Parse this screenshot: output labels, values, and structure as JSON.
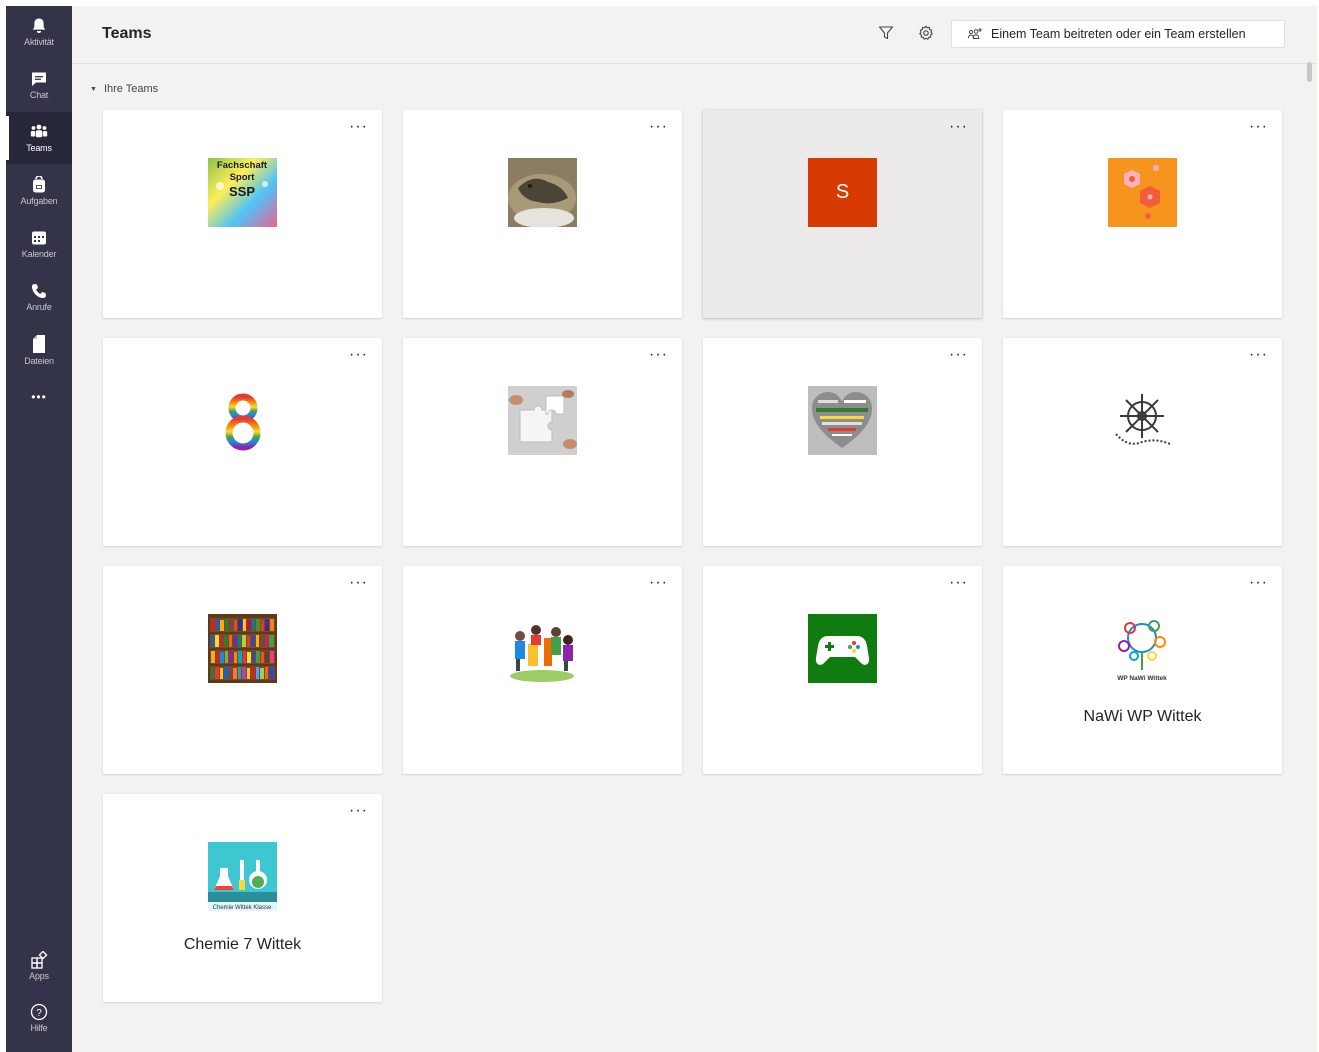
{
  "rail": {
    "items": [
      {
        "label": "Aktivität"
      },
      {
        "label": "Chat"
      },
      {
        "label": "Teams"
      },
      {
        "label": "Aufgaben"
      },
      {
        "label": "Kalender"
      },
      {
        "label": "Anrufe"
      },
      {
        "label": "Dateien"
      }
    ],
    "more": "•••",
    "apps": "Apps",
    "help": "Hilfe"
  },
  "header": {
    "title": "Teams",
    "join_button": "Einem Team beitreten oder ein Team erstellen"
  },
  "section": {
    "label": "Ihre Teams"
  },
  "cards": {
    "more": "···",
    "items": [
      {
        "avatar_text_1": "Fachschaft",
        "avatar_text_2": "Sport",
        "avatar_text_3": "SSP",
        "name": ""
      },
      {
        "name": ""
      },
      {
        "avatar_letter": "S",
        "name": ""
      },
      {
        "name": ""
      },
      {
        "name": ""
      },
      {
        "name": ""
      },
      {
        "name": ""
      },
      {
        "name": ""
      },
      {
        "name": ""
      },
      {
        "name": ""
      },
      {
        "name": ""
      },
      {
        "avatar_caption": "WP NaWi Wittek",
        "name": "NaWi WP Wittek"
      },
      {
        "avatar_caption": "Chemie Wittek Klasse",
        "name": "Chemie 7 Wittek"
      }
    ]
  },
  "colors": {
    "rail_bg": "#33344a",
    "page_bg": "#f3f2f1",
    "s_avatar": "#d83b01",
    "orange_avatar": "#f7941d",
    "game_avatar": "#107c10",
    "chem_avatar": "#3ec7d1"
  }
}
